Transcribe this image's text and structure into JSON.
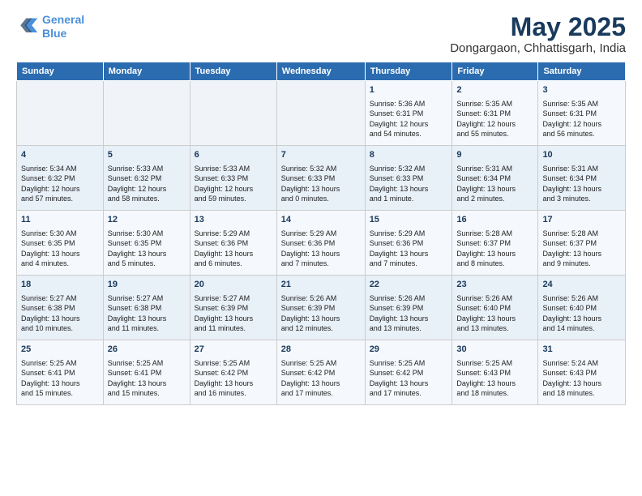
{
  "logo": {
    "line1": "General",
    "line2": "Blue"
  },
  "title": "May 2025",
  "subtitle": "Dongargaon, Chhattisgarh, India",
  "days_of_week": [
    "Sunday",
    "Monday",
    "Tuesday",
    "Wednesday",
    "Thursday",
    "Friday",
    "Saturday"
  ],
  "weeks": [
    [
      {
        "day": "",
        "content": ""
      },
      {
        "day": "",
        "content": ""
      },
      {
        "day": "",
        "content": ""
      },
      {
        "day": "",
        "content": ""
      },
      {
        "day": "1",
        "content": "Sunrise: 5:36 AM\nSunset: 6:31 PM\nDaylight: 12 hours\nand 54 minutes."
      },
      {
        "day": "2",
        "content": "Sunrise: 5:35 AM\nSunset: 6:31 PM\nDaylight: 12 hours\nand 55 minutes."
      },
      {
        "day": "3",
        "content": "Sunrise: 5:35 AM\nSunset: 6:31 PM\nDaylight: 12 hours\nand 56 minutes."
      }
    ],
    [
      {
        "day": "4",
        "content": "Sunrise: 5:34 AM\nSunset: 6:32 PM\nDaylight: 12 hours\nand 57 minutes."
      },
      {
        "day": "5",
        "content": "Sunrise: 5:33 AM\nSunset: 6:32 PM\nDaylight: 12 hours\nand 58 minutes."
      },
      {
        "day": "6",
        "content": "Sunrise: 5:33 AM\nSunset: 6:33 PM\nDaylight: 12 hours\nand 59 minutes."
      },
      {
        "day": "7",
        "content": "Sunrise: 5:32 AM\nSunset: 6:33 PM\nDaylight: 13 hours\nand 0 minutes."
      },
      {
        "day": "8",
        "content": "Sunrise: 5:32 AM\nSunset: 6:33 PM\nDaylight: 13 hours\nand 1 minute."
      },
      {
        "day": "9",
        "content": "Sunrise: 5:31 AM\nSunset: 6:34 PM\nDaylight: 13 hours\nand 2 minutes."
      },
      {
        "day": "10",
        "content": "Sunrise: 5:31 AM\nSunset: 6:34 PM\nDaylight: 13 hours\nand 3 minutes."
      }
    ],
    [
      {
        "day": "11",
        "content": "Sunrise: 5:30 AM\nSunset: 6:35 PM\nDaylight: 13 hours\nand 4 minutes."
      },
      {
        "day": "12",
        "content": "Sunrise: 5:30 AM\nSunset: 6:35 PM\nDaylight: 13 hours\nand 5 minutes."
      },
      {
        "day": "13",
        "content": "Sunrise: 5:29 AM\nSunset: 6:36 PM\nDaylight: 13 hours\nand 6 minutes."
      },
      {
        "day": "14",
        "content": "Sunrise: 5:29 AM\nSunset: 6:36 PM\nDaylight: 13 hours\nand 7 minutes."
      },
      {
        "day": "15",
        "content": "Sunrise: 5:29 AM\nSunset: 6:36 PM\nDaylight: 13 hours\nand 7 minutes."
      },
      {
        "day": "16",
        "content": "Sunrise: 5:28 AM\nSunset: 6:37 PM\nDaylight: 13 hours\nand 8 minutes."
      },
      {
        "day": "17",
        "content": "Sunrise: 5:28 AM\nSunset: 6:37 PM\nDaylight: 13 hours\nand 9 minutes."
      }
    ],
    [
      {
        "day": "18",
        "content": "Sunrise: 5:27 AM\nSunset: 6:38 PM\nDaylight: 13 hours\nand 10 minutes."
      },
      {
        "day": "19",
        "content": "Sunrise: 5:27 AM\nSunset: 6:38 PM\nDaylight: 13 hours\nand 11 minutes."
      },
      {
        "day": "20",
        "content": "Sunrise: 5:27 AM\nSunset: 6:39 PM\nDaylight: 13 hours\nand 11 minutes."
      },
      {
        "day": "21",
        "content": "Sunrise: 5:26 AM\nSunset: 6:39 PM\nDaylight: 13 hours\nand 12 minutes."
      },
      {
        "day": "22",
        "content": "Sunrise: 5:26 AM\nSunset: 6:39 PM\nDaylight: 13 hours\nand 13 minutes."
      },
      {
        "day": "23",
        "content": "Sunrise: 5:26 AM\nSunset: 6:40 PM\nDaylight: 13 hours\nand 13 minutes."
      },
      {
        "day": "24",
        "content": "Sunrise: 5:26 AM\nSunset: 6:40 PM\nDaylight: 13 hours\nand 14 minutes."
      }
    ],
    [
      {
        "day": "25",
        "content": "Sunrise: 5:25 AM\nSunset: 6:41 PM\nDaylight: 13 hours\nand 15 minutes."
      },
      {
        "day": "26",
        "content": "Sunrise: 5:25 AM\nSunset: 6:41 PM\nDaylight: 13 hours\nand 15 minutes."
      },
      {
        "day": "27",
        "content": "Sunrise: 5:25 AM\nSunset: 6:42 PM\nDaylight: 13 hours\nand 16 minutes."
      },
      {
        "day": "28",
        "content": "Sunrise: 5:25 AM\nSunset: 6:42 PM\nDaylight: 13 hours\nand 17 minutes."
      },
      {
        "day": "29",
        "content": "Sunrise: 5:25 AM\nSunset: 6:42 PM\nDaylight: 13 hours\nand 17 minutes."
      },
      {
        "day": "30",
        "content": "Sunrise: 5:25 AM\nSunset: 6:43 PM\nDaylight: 13 hours\nand 18 minutes."
      },
      {
        "day": "31",
        "content": "Sunrise: 5:24 AM\nSunset: 6:43 PM\nDaylight: 13 hours\nand 18 minutes."
      }
    ]
  ]
}
